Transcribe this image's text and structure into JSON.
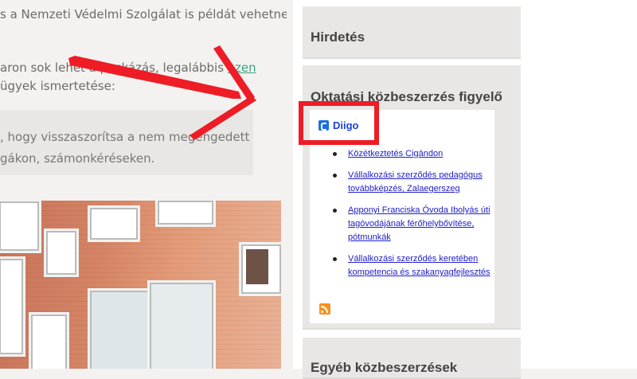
{
  "article": {
    "line1": "s a Nemzeti Védelmi Szolgálat is példát vehetne",
    "line2_text": "aron sok lehet a puskázás, legalábbis ",
    "line2_link": "ezen",
    "line3": "ügyek ismertetése:",
    "quote_line1": ", hogy visszaszorítsa a nem megengedett",
    "quote_line2": "gákon, számonkéréseken."
  },
  "sidebar": {
    "widget1_title": "Hirdetés",
    "widget2_title": "Oktatási közbeszerzés figyelő",
    "widget3_title": "Egyéb közbeszerzések"
  },
  "diigo": {
    "name": "Diigo",
    "items": [
      "Közétkeztetés Cigándon",
      "Vállalkozási szerződés pedagógus továbbképzés, Zalaegerszeg",
      "Apponyi Franciska Óvoda Ibolyás úti tagóvodájának férőhelybővítése, pótmunkák",
      "Vállalkozási szerződés keretében kompetencia és szakanyagfejlesztés"
    ]
  },
  "colors": {
    "highlight": "#ee1c25",
    "link": "#3aa17e",
    "diigo_blue": "#1a6fe0"
  }
}
